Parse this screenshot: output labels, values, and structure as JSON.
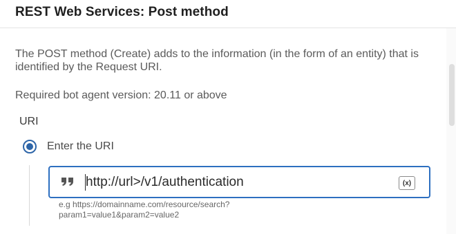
{
  "header": {
    "title": "REST Web Services: Post method"
  },
  "content": {
    "description": "The POST method (Create) adds to the information (in the form of an entity) that is identified by the Request URI.",
    "version_note": "Required bot agent version: 20.11 or above"
  },
  "uri_section": {
    "label": "URI",
    "option_label": "Enter the URI",
    "option_selected": true,
    "input_value": "http://url>/v1/authentication",
    "variable_button_label": "(x)",
    "hint_line1": "e.g https://domainname.com/resource/search?",
    "hint_line2": "param1=value1&param2=value2"
  },
  "icons": {
    "quote": "quote-icon",
    "variable": "variable-insert-icon"
  },
  "colors": {
    "accent": "#2d6fc0",
    "text_primary": "#1f1f1f",
    "text_secondary": "#5a5a5a"
  }
}
